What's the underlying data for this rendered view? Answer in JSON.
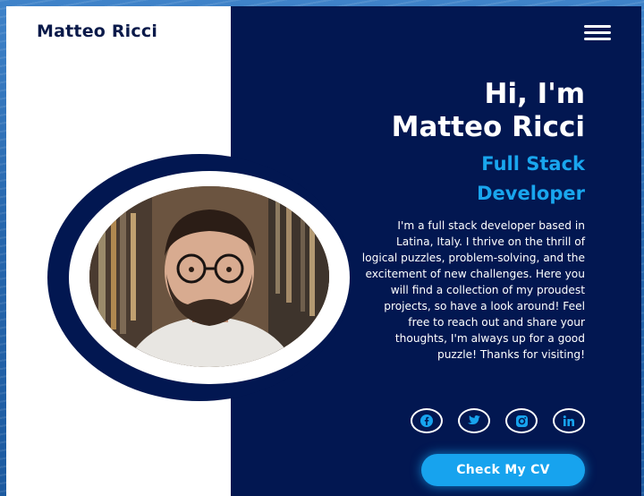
{
  "header": {
    "brand": "Matteo Ricci",
    "menu_icon": "hamburger-menu-icon"
  },
  "hero": {
    "greeting_line1": "Hi, I'm",
    "greeting_line2": "Matteo Ricci",
    "role": "Full Stack Developer",
    "bio": "I'm a full stack developer based in Latina, Italy. I thrive on the thrill of logical puzzles, problem-solving, and the excitement of new challenges. Here you will find a collection of my proudest projects, so have a look around! Feel free to reach out and share your thoughts, I'm always up for a good puzzle! Thanks for visiting!"
  },
  "socials": [
    {
      "icon": "facebook-icon"
    },
    {
      "icon": "twitter-icon"
    },
    {
      "icon": "instagram-icon"
    },
    {
      "icon": "linkedin-icon"
    }
  ],
  "cta": {
    "label": "Check My CV"
  },
  "colors": {
    "navy": "#021751",
    "accent": "#17a3ee",
    "white": "#ffffff"
  }
}
